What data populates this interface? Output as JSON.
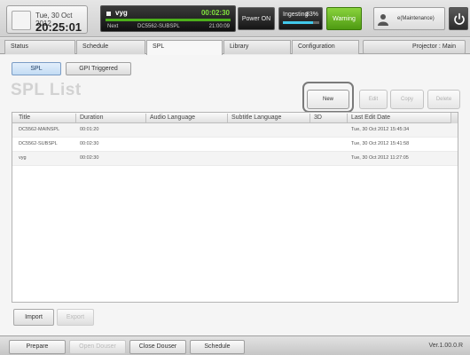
{
  "header": {
    "date": "Tue, 30 Oct 2012",
    "time": "20:25:01",
    "now_playing": {
      "title": "vyg",
      "elapsed": "00:02:30",
      "progress": 1.0,
      "next_label": "Next",
      "next_title": "DC5562-SUBSPL",
      "next_time": "21:00:09"
    },
    "power_label": "Power ON",
    "ingest": {
      "label": "Ingesting",
      "percent_text": "83%",
      "progress": 0.83
    },
    "warning_label": "Warning",
    "user_name": "e(Maintenance)"
  },
  "tabs": [
    {
      "label": "Status"
    },
    {
      "label": "Schedule"
    },
    {
      "label": "SPL"
    },
    {
      "label": "Library"
    },
    {
      "label": "Configuration"
    }
  ],
  "projector_label": "Projector : Main",
  "subtabs": [
    {
      "label": "SPL"
    },
    {
      "label": "GPI Triggered"
    }
  ],
  "page_title": "SPL List",
  "actions": {
    "new": "New",
    "edit": "Edit",
    "copy": "Copy",
    "delete": "Delete"
  },
  "table": {
    "columns": [
      "Title",
      "Duration",
      "Audio Language",
      "Subtitle Language",
      "3D",
      "Last Edit Date"
    ],
    "rows": [
      {
        "title": "DC5562-MAINSPL",
        "duration": "00:01:20",
        "audio": "",
        "subtitle": "",
        "three_d": "",
        "last_edit": "Tue, 30 Oct 2012 15:45:34"
      },
      {
        "title": "DC5562-SUBSPL",
        "duration": "00:02:30",
        "audio": "",
        "subtitle": "",
        "three_d": "",
        "last_edit": "Tue, 30 Oct 2012 15:41:58"
      },
      {
        "title": "vyg",
        "duration": "00:02:30",
        "audio": "",
        "subtitle": "",
        "three_d": "",
        "last_edit": "Tue, 30 Oct 2012 11:27:05"
      }
    ]
  },
  "footer": {
    "import_label": "Import",
    "export_label": "Export"
  },
  "bottombar": {
    "prepare": "Prepare",
    "open_douser": "Open Douser",
    "close_douser": "Close Douser",
    "schedule": "Schedule",
    "version": "Ver.1.00.0.R"
  },
  "colors": {
    "accent_green": "#7fe03c",
    "ingest_blue": "#42c8ea",
    "warning_green": "#6cbf2a",
    "active_subtab": "#c3dcf4"
  }
}
